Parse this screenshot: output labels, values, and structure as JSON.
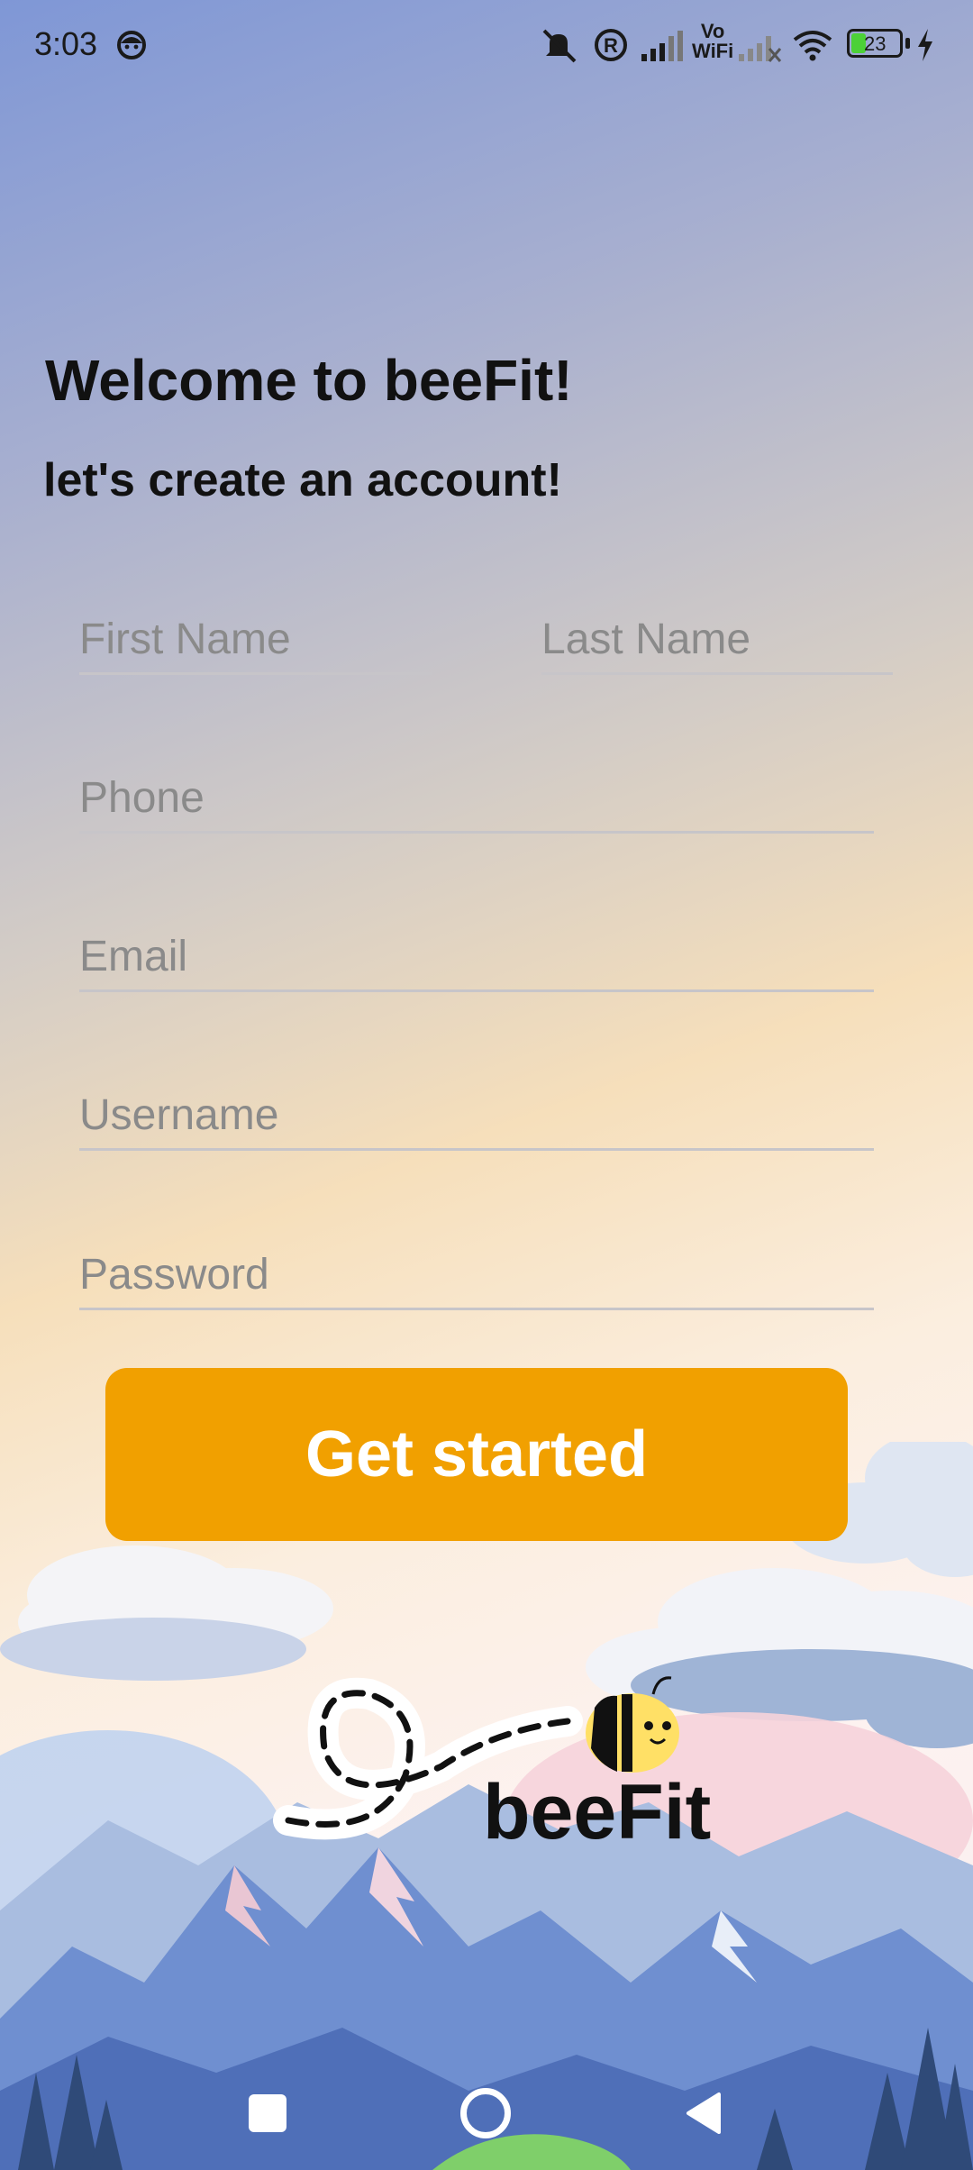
{
  "status_bar": {
    "time": "3:03",
    "battery": "23",
    "vowifi": [
      "Vo",
      "WiFi"
    ],
    "icons": [
      "face-icon",
      "mute-icon",
      "registered-icon",
      "signal-icon",
      "vowifi-icon",
      "signal-off-icon",
      "wifi-icon",
      "battery-icon",
      "charging-icon"
    ]
  },
  "header": {
    "welcome": "Welcome to beeFit!",
    "subtitle": "let's create an account!"
  },
  "form": {
    "first_name": {
      "placeholder": "First Name",
      "value": ""
    },
    "last_name": {
      "placeholder": "Last Name",
      "value": ""
    },
    "phone": {
      "placeholder": "Phone",
      "value": ""
    },
    "email": {
      "placeholder": "Email",
      "value": ""
    },
    "username": {
      "placeholder": "Username",
      "value": ""
    },
    "password": {
      "placeholder": "Password",
      "value": ""
    }
  },
  "cta": {
    "label": "Get started"
  },
  "logo": {
    "text": "beeFit"
  },
  "nav": {
    "icons": [
      "recents-icon",
      "home-icon",
      "back-icon"
    ]
  },
  "colors": {
    "accent": "#f1a000",
    "text": "#111111",
    "placeholder": "#8a8a8a",
    "underline": "#c7c5c9"
  }
}
